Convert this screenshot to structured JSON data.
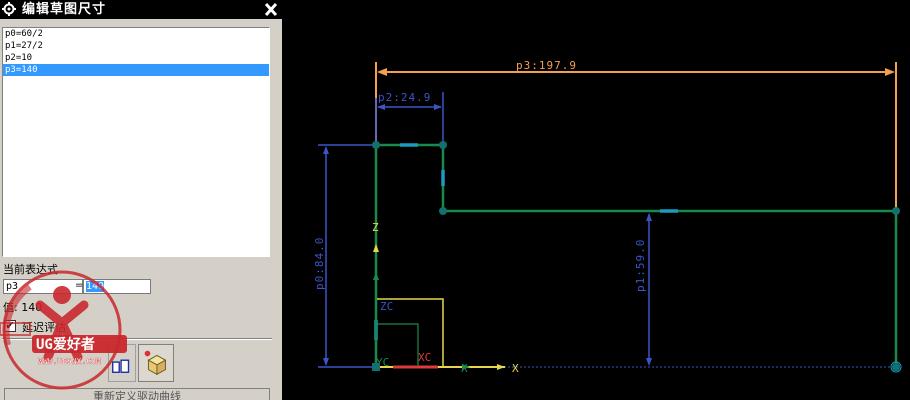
{
  "dialog": {
    "title": "编辑草图尺寸",
    "expressions": [
      "p0=60/2",
      "p1=27/2",
      "p2=10",
      "p3=140"
    ],
    "selected_index": 3,
    "current_expr_label": "当前表达式",
    "current_expr_name": "p3",
    "current_expr_value": "140",
    "value_label": "值: 140",
    "delay_eval_label": "延迟评估",
    "delay_eval_checked": "✔",
    "bottom_button_label": "重新定义驱动曲线"
  },
  "watermark": {
    "brand": "UG爱好者",
    "url": "WWW.UGSNX.COM"
  },
  "canvas": {
    "dim_p3": "p3:197.9",
    "dim_p2": "p2:24.9",
    "dim_p0": "p0:84.0",
    "dim_p1": "p1:59.0",
    "axis_z": "Z",
    "axis_zc": "ZC",
    "axis_yc": "YC",
    "axis_xc": "XC",
    "axis_x1": "X",
    "axis_x2": "X",
    "colors": {
      "sketch": "#1a8a4a",
      "sketch_point": "#12706e",
      "dim_orange": "#f2a050",
      "dim_blue": "#3a55c8",
      "axis_yellow": "#e6d84a",
      "axis_red": "#e03a3a"
    }
  }
}
